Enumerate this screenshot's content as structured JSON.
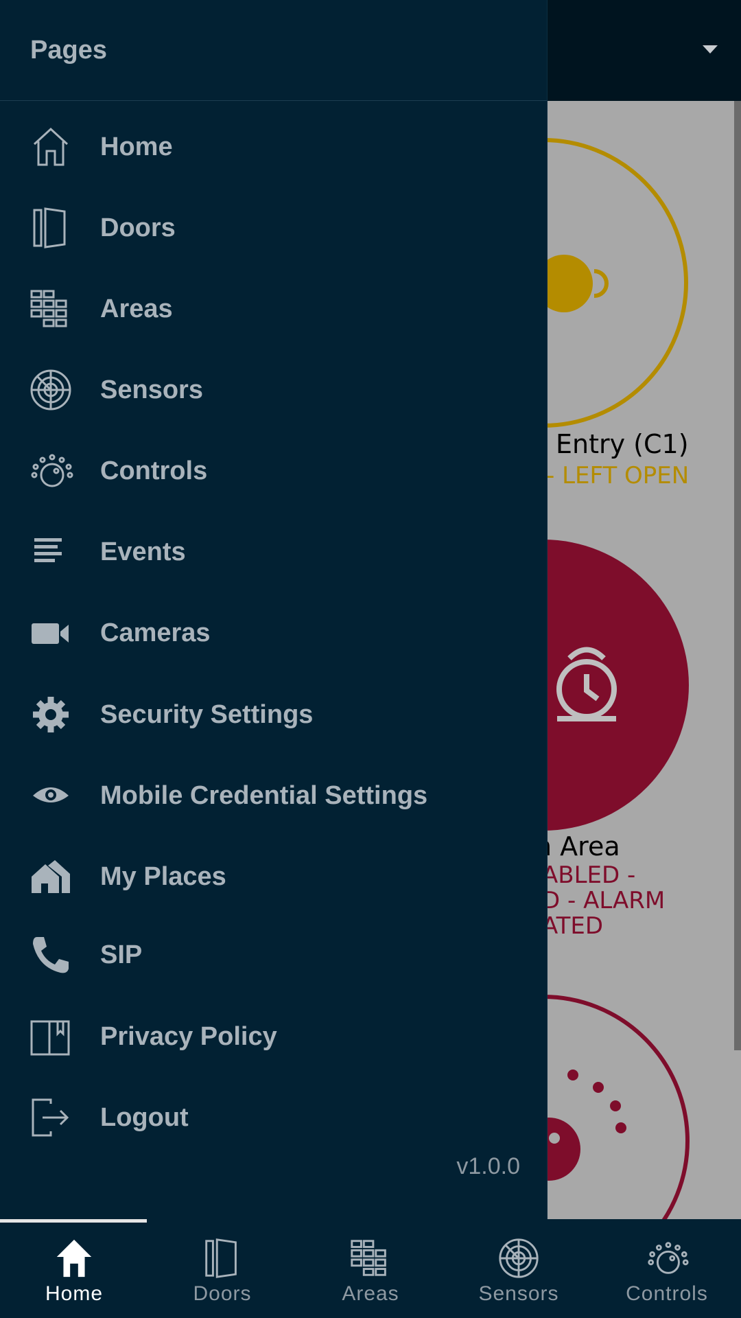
{
  "drawer": {
    "title": "Pages",
    "version": "v1.0.0",
    "items": [
      {
        "label": "Home",
        "icon": "home-icon"
      },
      {
        "label": "Doors",
        "icon": "door-icon"
      },
      {
        "label": "Areas",
        "icon": "areas-icon"
      },
      {
        "label": "Sensors",
        "icon": "sensor-icon"
      },
      {
        "label": "Controls",
        "icon": "controls-icon"
      },
      {
        "label": "Events",
        "icon": "events-icon"
      },
      {
        "label": "Cameras",
        "icon": "camera-icon"
      },
      {
        "label": "Security Settings",
        "icon": "gear-icon"
      },
      {
        "label": "Mobile Credential Settings",
        "icon": "eye-icon"
      },
      {
        "label": "My Places",
        "icon": "places-icon"
      },
      {
        "label": "SIP",
        "icon": "phone-icon"
      },
      {
        "label": "Privacy Policy",
        "icon": "book-icon"
      },
      {
        "label": "Logout",
        "icon": "logout-icon"
      }
    ]
  },
  "content": {
    "door_name": "Entry (C1)",
    "door_status": "- LEFT OPEN",
    "area_name": "n Area",
    "area_status": [
      "ABLED -",
      "D - ALARM",
      "ATED"
    ]
  },
  "nav": {
    "active": "Home",
    "tabs": [
      {
        "label": "Home"
      },
      {
        "label": "Doors"
      },
      {
        "label": "Areas"
      },
      {
        "label": "Sensors"
      },
      {
        "label": "Controls"
      }
    ]
  },
  "colors": {
    "drawer_bg": "#022133",
    "warning": "#b48c00",
    "alarm": "#7e0d2b",
    "text": "#a9b3bb"
  }
}
